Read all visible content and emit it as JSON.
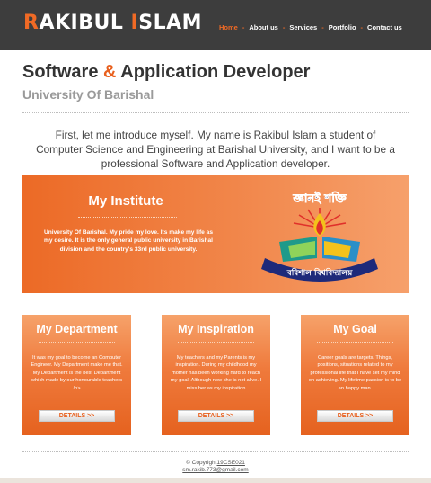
{
  "header": {
    "logo_first": "R",
    "logo_mid": "AKIBUL ",
    "logo_i": "I",
    "logo_rest": "SLAM",
    "nav": [
      "Home",
      "About us",
      "Services",
      "Portfolio",
      "Contact us"
    ],
    "nav_separator": "-",
    "active_nav": "Home"
  },
  "intro": {
    "title_part1": "Software ",
    "title_amp": "&",
    "title_part2": " Application Developer",
    "subtitle": "University Of Barishal",
    "paragraph": "First, let me introduce myself. My name is Rakibul Islam a student of Computer Science and Engineering at Barishal University, and I want to be a professional Software and Application developer."
  },
  "institute": {
    "title": "My Institute",
    "text": "University Of Barishal. My pride my love. Its make my life as my desire. It is the only general public university in Barishal division and the country's 33rd public university.",
    "seal_top_text": "জ্ঞানই শক্তি",
    "seal_bottom_text": "বরিশাল বিশ্ববিদ্যালয়"
  },
  "cards": [
    {
      "title": "My Department",
      "text": "It was my goal to become an Computer Engineer. My Department make me that. My Department is the best Department which made by our honourable teachers /p>",
      "button": "DETAILS >>"
    },
    {
      "title": "My Inspiration",
      "text": "My teachers and my Parents is my inspiration. During my childhood my mother has been working hard to reach my goal. Although now she is not alive. I miss her as my inspiration",
      "button": "DETAILS >>"
    },
    {
      "title": "My Goal",
      "text": "Career goals are targets. Things, positions, situations related to my professional life that I have set my mind on achieving. My lifetime passion is to be an happy man.",
      "button": "DETAILS >>"
    }
  ],
  "footer": {
    "copyright_prefix": "© Copyright",
    "copyright_link": "19CSE021",
    "email": "sm.rakib.773@gmail.com"
  },
  "colors": {
    "accent": "#f06a25",
    "header_bg": "#3d3d3d"
  }
}
